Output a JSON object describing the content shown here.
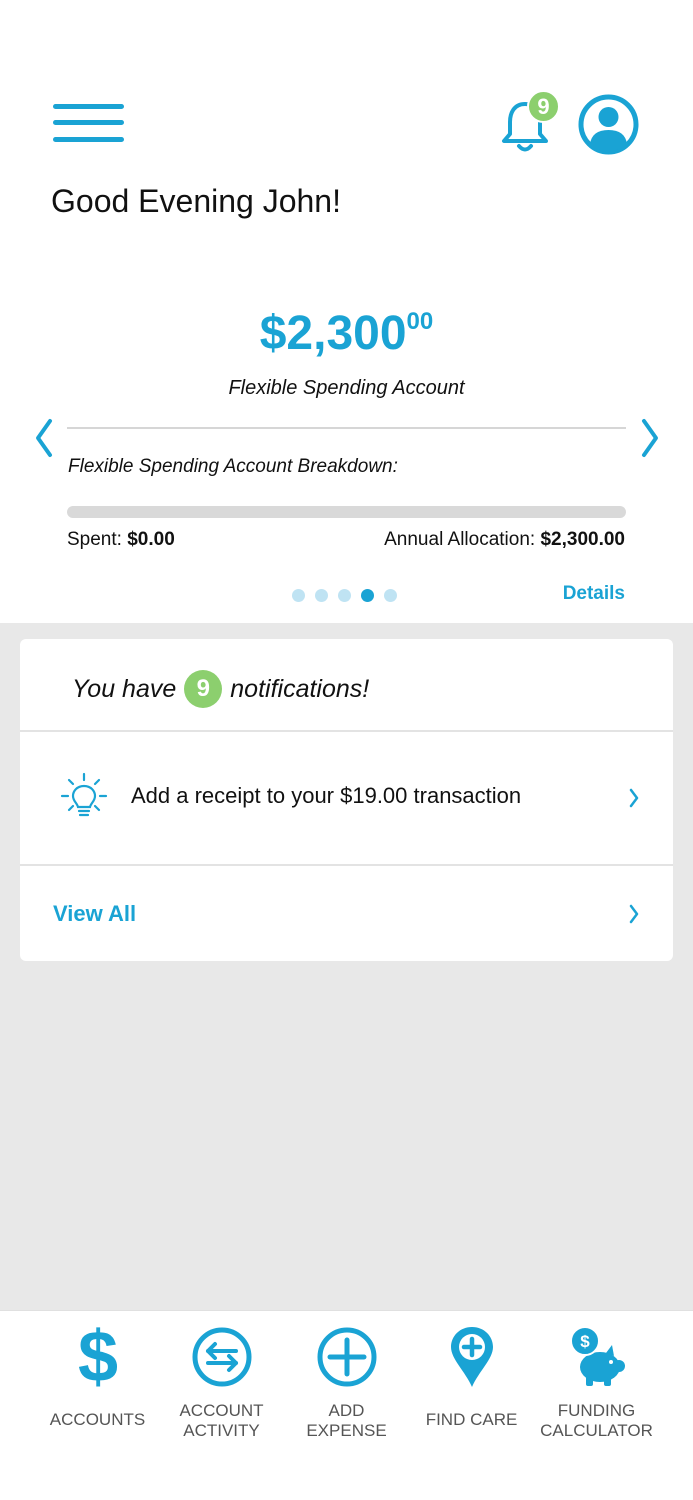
{
  "header": {
    "notification_count": "9",
    "greeting": "Good Evening John!"
  },
  "account": {
    "amount_dollars": "$2,300",
    "amount_cents": "00",
    "name": "Flexible Spending Account",
    "breakdown_title": "Flexible Spending Account Breakdown:",
    "spent_label": "Spent:",
    "spent_value": "$0.00",
    "allocation_label": "Annual Allocation:",
    "allocation_value": "$2,300.00",
    "spent_fraction": 0,
    "details_label": "Details",
    "pager": {
      "count": 5,
      "active_index": 3
    }
  },
  "notifications": {
    "prefix": "You have",
    "count": "9",
    "suffix": "notifications!",
    "item_text": "Add a receipt to your $19.00 transaction",
    "view_all": "View All"
  },
  "bottom_nav": {
    "accounts": "ACCOUNTS",
    "account_activity_1": "ACCOUNT",
    "account_activity_2": "ACTIVITY",
    "add_expense_1": "ADD",
    "add_expense_2": "EXPENSE",
    "find_care": "FIND CARE",
    "funding_calculator_1": "FUNDING",
    "funding_calculator_2": "CALCULATOR"
  },
  "colors": {
    "accent": "#1aa3d4",
    "badge": "#8ccf6e",
    "background_gray": "#e8e8e8"
  },
  "icons": [
    "menu-icon",
    "bell-icon",
    "user-icon",
    "chevron-left-icon",
    "chevron-right-icon",
    "lightbulb-icon",
    "dollar-icon",
    "transfer-icon",
    "plus-circle-icon",
    "map-pin-plus-icon",
    "piggy-bank-icon"
  ]
}
